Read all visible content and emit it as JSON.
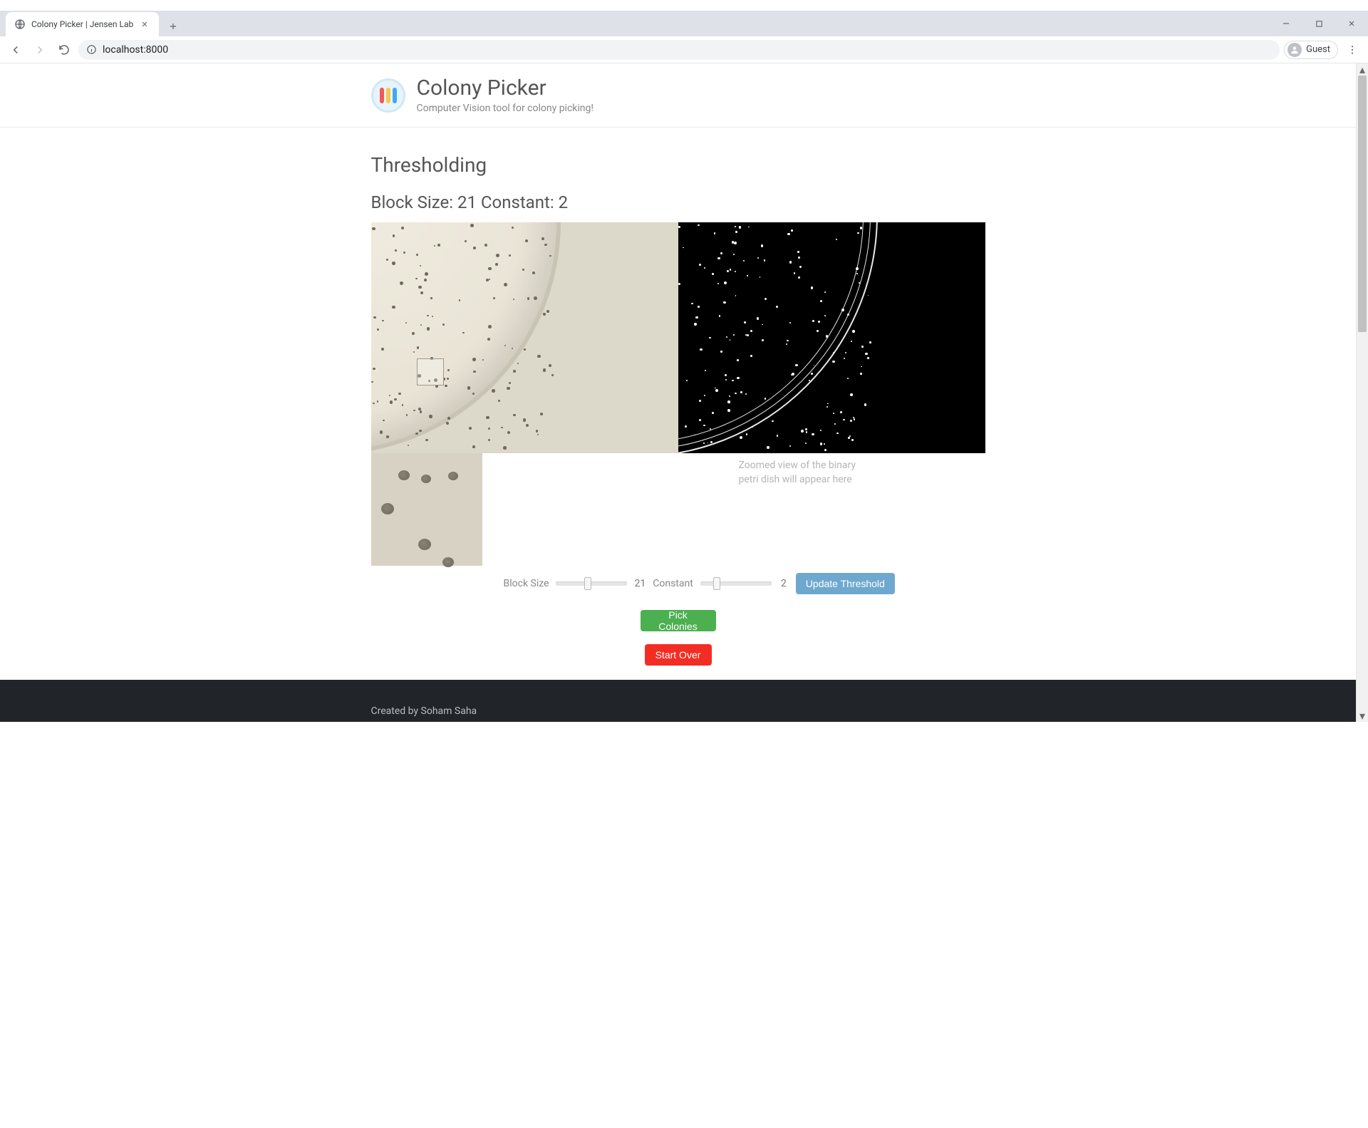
{
  "browser": {
    "tab_title": "Colony Picker | Jensen Lab",
    "url": "localhost:8000",
    "guest_label": "Guest"
  },
  "header": {
    "app_title": "Colony Picker",
    "tagline": "Computer Vision tool for colony picking!"
  },
  "thresholding": {
    "heading": "Thresholding",
    "params_line": "Block Size: 21 Constant: 2",
    "block_size_label": "Block Size",
    "block_size_value": "21",
    "constant_label": "Constant",
    "constant_value": "2",
    "placeholder_line1": "Zoomed view of the binary",
    "placeholder_line2": "petri dish will appear here",
    "update_btn": "Update Threshold",
    "pick_btn": "Pick Colonies",
    "start_over_btn": "Start Over"
  },
  "footer": {
    "credit": "Created by Soham Saha"
  }
}
